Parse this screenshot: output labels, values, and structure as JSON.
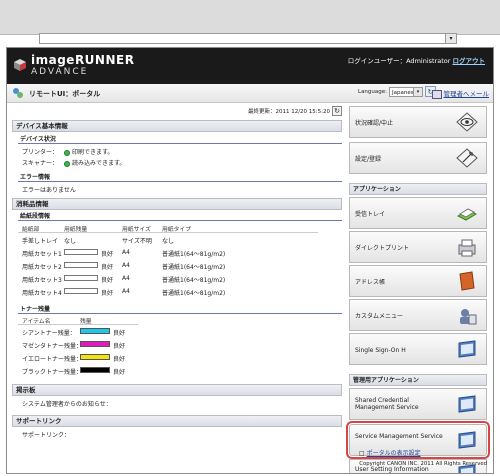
{
  "header": {
    "brand": "imageRUNNER",
    "brand_sub": "ADVANCE",
    "login_text": "ログインユーザー：Administrator",
    "logout": "ログアウト"
  },
  "toolbar": {
    "title": "リモートUI：ポータル",
    "language_label": "Language:",
    "language_value": "Japanese",
    "admin_mail": "管理者へメール"
  },
  "main": {
    "last_updated": "最終更新：2011 12/20 15:5:20",
    "device_info": {
      "title": "デバイス基本情報",
      "status_title": "デバイス状況",
      "printer_label": "プリンター：",
      "printer_status": "印刷できます。",
      "scanner_label": "スキャナー：",
      "scanner_status": "読み込みできます。",
      "error_title": "エラー情報",
      "error_text": "エラーはありません"
    },
    "consumables": {
      "title": "消耗品情報",
      "paper_title": "給紙段情報",
      "paper_headers": [
        "給紙部",
        "用紙残量",
        "用紙サイズ",
        "用紙タイプ"
      ],
      "paper_rows": [
        {
          "source": "手差しトレイ",
          "level": "なし",
          "size": "サイズ不明",
          "type": "なし"
        },
        {
          "source": "用紙カセット1",
          "level": "良好",
          "size": "A4",
          "type": "普通紙1(64〜81g/m2)"
        },
        {
          "source": "用紙カセット2",
          "level": "良好",
          "size": "A4",
          "type": "普通紙1(64〜81g/m2)"
        },
        {
          "source": "用紙カセット3",
          "level": "良好",
          "size": "A4",
          "type": "普通紙1(64〜81g/m2)"
        },
        {
          "source": "用紙カセット4",
          "level": "良好",
          "size": "A4",
          "type": "普通紙1(64〜81g/m2)"
        }
      ],
      "toner_title": "トナー残量",
      "toner_headers": [
        "アイテム名",
        "残量"
      ],
      "toner_rows": [
        {
          "name": "シアントナー残量：",
          "level": "良好",
          "color": "#1ec8e6"
        },
        {
          "name": "マゼンタトナー残量：",
          "level": "良好",
          "color": "#e21bbf"
        },
        {
          "name": "イエロートナー残量：",
          "level": "良好",
          "color": "#f2e20f"
        },
        {
          "name": "ブラックトナー残量：",
          "level": "良好",
          "color": "#000000"
        }
      ]
    },
    "message_board": {
      "title": "掲示板",
      "text": "システム管理者からのお知らせ："
    },
    "support": {
      "title": "サポートリンク",
      "text": "サポートリンク："
    }
  },
  "side": {
    "status_button": "状況確認/中止",
    "settings_button": "設定/登録",
    "apps_title": "アプリケーション",
    "apps": [
      {
        "label": "受信トレイ",
        "icon": "inbox-icon"
      },
      {
        "label": "ダイレクトプリント",
        "icon": "printer-icon"
      },
      {
        "label": "アドレス帳",
        "icon": "address-book-icon"
      },
      {
        "label": "カスタムメニュー",
        "icon": "custom-menu-icon"
      },
      {
        "label": "Single Sign-On H",
        "icon": "monitor-icon"
      }
    ],
    "mgmt_title": "管理用アプリケーション",
    "mgmt": [
      {
        "label": "Shared Credential Management Service",
        "icon": "monitor-icon"
      },
      {
        "label": "Service Management Service",
        "icon": "monitor-icon",
        "selected": true
      },
      {
        "label": "User Setting Information Management Service",
        "icon": "monitor-icon"
      }
    ],
    "portal_display": "ポータルの表示設定",
    "copyright": "Copyright CANON INC. 2011 All Rights Reserved"
  },
  "colors": {
    "header_bg": "#1a1a1a",
    "status_green": "#3cb44b",
    "selected_outline": "#d84545",
    "link_blue": "#224499"
  }
}
